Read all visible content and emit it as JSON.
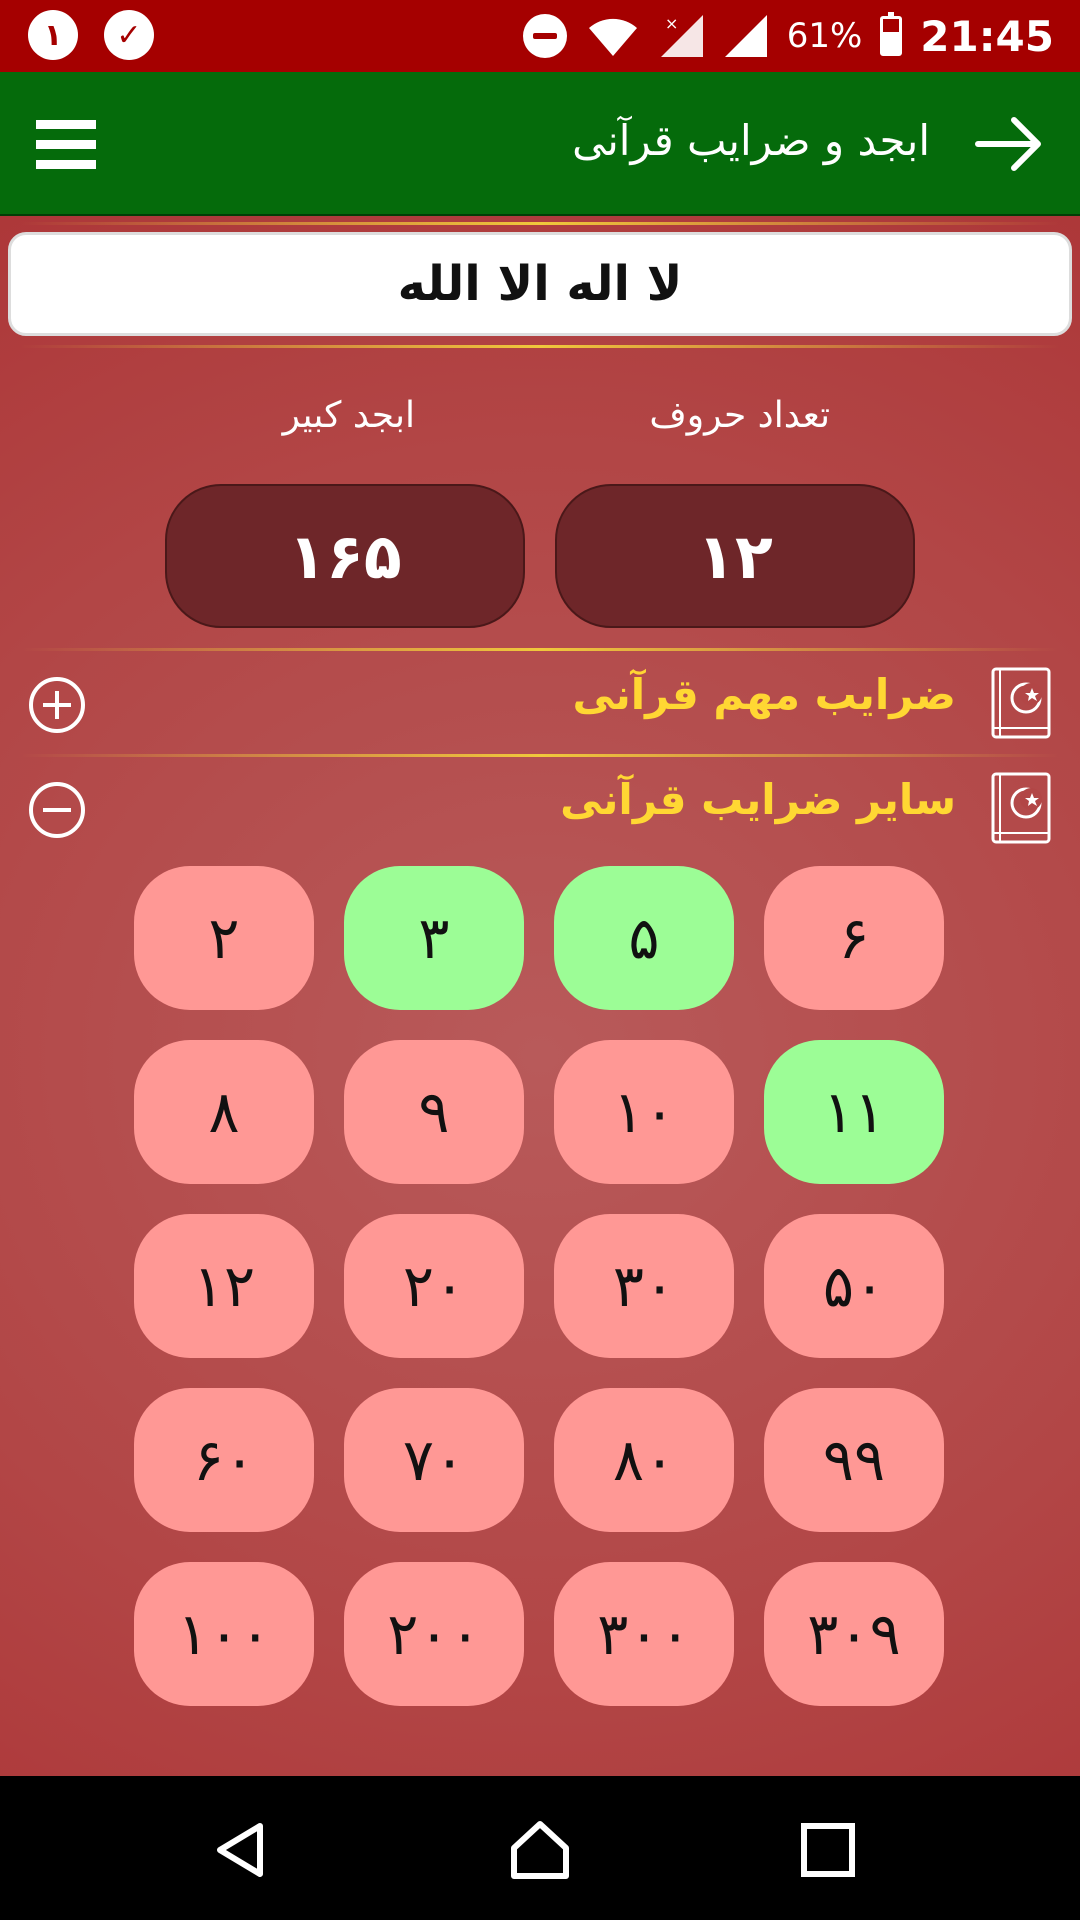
{
  "status_bar": {
    "notif_1": "١",
    "notif_2": "✓",
    "battery": "61%",
    "battery_level": 0.61,
    "time": "21:45"
  },
  "toolbar": {
    "title": "ابجد و ضرایب قرآنی"
  },
  "input": {
    "phrase": "لا اله الا الله"
  },
  "stats": {
    "letters_label": "تعداد حروف",
    "letters_value": "١٢",
    "abjad_label": "ابجد کبیر",
    "abjad_value": "١۶۵"
  },
  "sections": [
    {
      "title": "ضرایب مهم قرآنی",
      "state": "collapsed"
    },
    {
      "title": "سایر ضرایب قرآنی",
      "state": "expanded"
    }
  ],
  "coefficients": [
    {
      "label": "۶",
      "match": false
    },
    {
      "label": "۵",
      "match": true
    },
    {
      "label": "٣",
      "match": true
    },
    {
      "label": "٢",
      "match": false
    },
    {
      "label": "١١",
      "match": true
    },
    {
      "label": "١٠",
      "match": false
    },
    {
      "label": "٩",
      "match": false
    },
    {
      "label": "٨",
      "match": false
    },
    {
      "label": "۵٠",
      "match": false
    },
    {
      "label": "٣٠",
      "match": false
    },
    {
      "label": "٢٠",
      "match": false
    },
    {
      "label": "١٢",
      "match": false
    },
    {
      "label": "٩٩",
      "match": false
    },
    {
      "label": "٨٠",
      "match": false
    },
    {
      "label": "٧٠",
      "match": false
    },
    {
      "label": "۶٠",
      "match": false
    },
    {
      "label": "٣٠٩",
      "match": false
    },
    {
      "label": "٣٠٠",
      "match": false
    },
    {
      "label": "٢٠٠",
      "match": false
    },
    {
      "label": "١٠٠",
      "match": false
    }
  ],
  "colors": {
    "status_bar": "#a50000",
    "toolbar": "#056b0b",
    "match_tile": "#9cfd96",
    "nomatch_tile": "#ff9895",
    "section_title": "#ffd733"
  }
}
